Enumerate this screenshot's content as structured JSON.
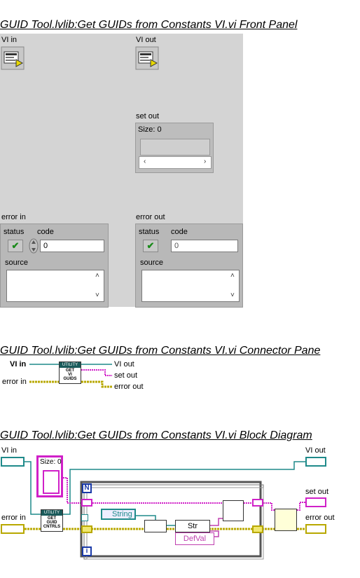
{
  "front_panel": {
    "heading": "GUID Tool.lvlib:Get GUIDs from Constants VI.vi Front Panel",
    "vi_in_label": "VI in",
    "vi_out_label": "VI out",
    "set_out_label": "set out",
    "set_out_size": "Size: 0",
    "error_in": {
      "label": "error in",
      "status_label": "status",
      "code_label": "code",
      "code_value": "0",
      "source_label": "source"
    },
    "error_out": {
      "label": "error out",
      "status_label": "status",
      "code_label": "code",
      "code_value": "0",
      "source_label": "source"
    }
  },
  "connector_pane": {
    "heading": "GUID Tool.lvlib:Get GUIDs from Constants VI.vi Connector Pane",
    "vi_in": "VI in",
    "error_in": "error in",
    "vi_out": "VI out",
    "set_out": "set out",
    "error_out": "error out",
    "icon_lines": [
      "UTILITY",
      "GET",
      "VI",
      "GUIDS"
    ]
  },
  "block_diagram": {
    "heading": "GUID Tool.lvlib:Get GUIDs from Constants VI.vi Block Diagram",
    "vi_in": "VI in",
    "error_in": "error in",
    "vi_out": "VI out",
    "set_out": "set out",
    "error_out": "error out",
    "size_label": "Size: 0",
    "loop_count": "N",
    "loop_index": "i",
    "string_const": "String",
    "to_str": "Str",
    "default_val": "DefVal",
    "subvi_lines": [
      "UTILITY",
      "GET",
      "GUID",
      "CNTRLS"
    ]
  },
  "colors": {
    "panel_bg": "#d4d4d4",
    "refnum_wire": "#1f8a8a",
    "error_wire": "#b8a800",
    "set_wire": "#d020c8",
    "string_wire": "#c040b0"
  }
}
